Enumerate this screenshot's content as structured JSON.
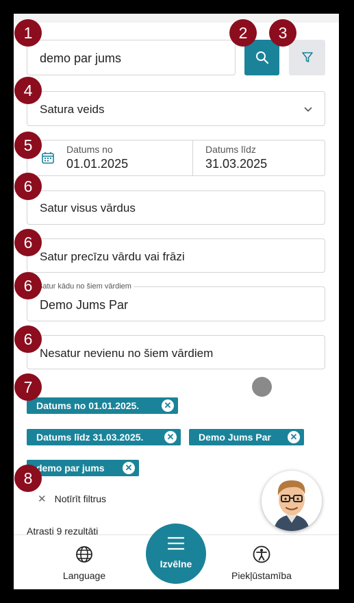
{
  "search": {
    "value": "demo par jums"
  },
  "content_type": {
    "label": "Satura veids"
  },
  "dates": {
    "from_label": "Datums no",
    "from_value": "01.01.2025",
    "to_label": "Datums līdz",
    "to_value": "31.03.2025"
  },
  "fields": {
    "all_words": "Satur visus vārdus",
    "exact_phrase": "Satur precīzu vārdu vai frāzi",
    "any_words_label": "Satur kādu no šiem vārdiem",
    "any_words_value": "Demo Jums Par",
    "none_words": "Nesatur nevienu no šiem vārdiem"
  },
  "chips": [
    {
      "label": "Datums no 01.01.2025."
    },
    {
      "label": "Datums līdz 31.03.2025."
    },
    {
      "label": "Demo Jums Par"
    },
    {
      "label": "demo par jums"
    }
  ],
  "clear_filters": "Notīrīt filtrus",
  "results": "Atrasti 9 rezultāti",
  "nav": {
    "language": "Language",
    "menu": "Izvēlne",
    "accessibility": "Piekļūstamība"
  },
  "badges": [
    "1",
    "2",
    "3",
    "4",
    "5",
    "6",
    "6",
    "6",
    "6",
    "7",
    "8"
  ],
  "colors": {
    "accent": "#1a8399",
    "badge": "#8b0d1e"
  },
  "icons": {
    "search": "search-icon",
    "filter": "filter-icon",
    "calendar": "calendar-icon",
    "menu": "menu-icon",
    "globe": "globe-icon",
    "accessibility": "accessibility-icon"
  }
}
